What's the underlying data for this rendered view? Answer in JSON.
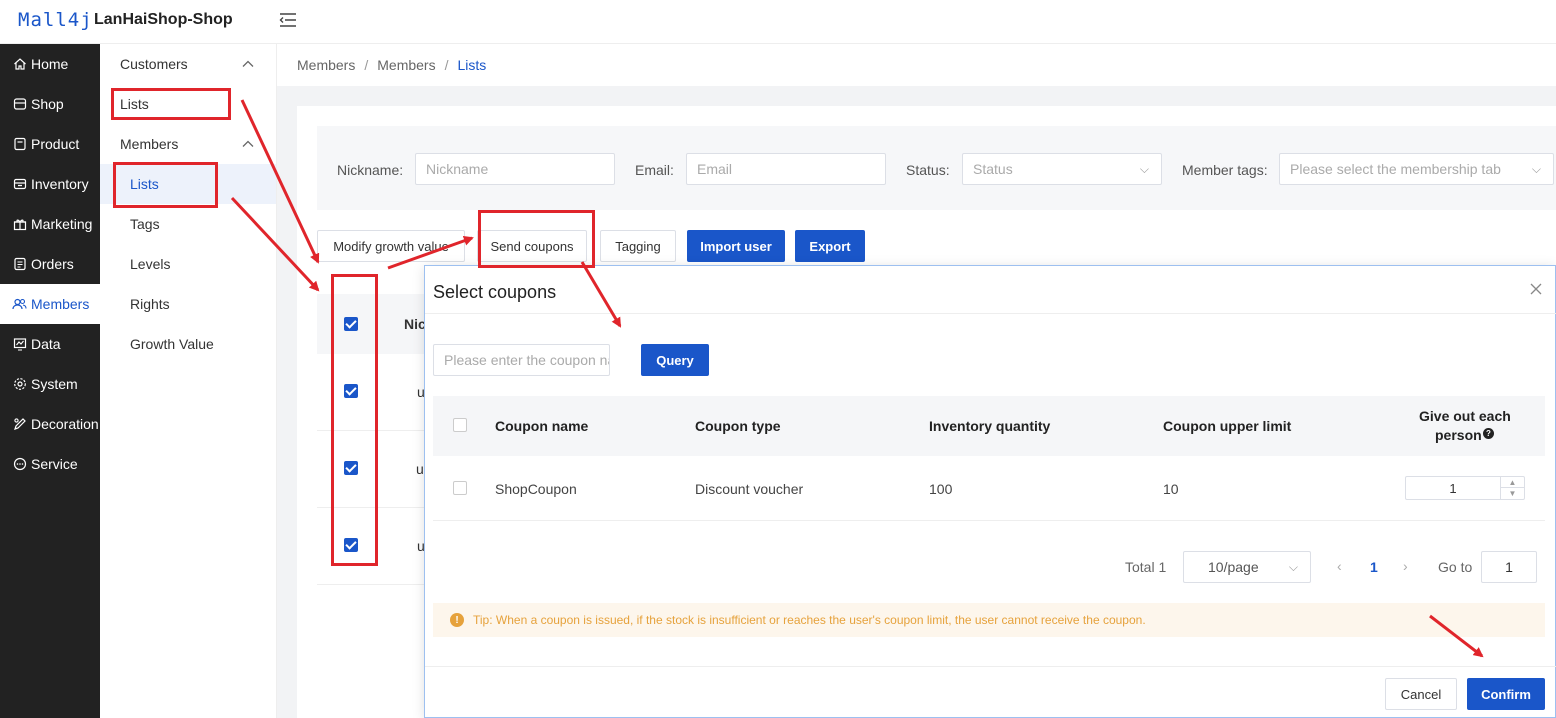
{
  "header": {
    "logo": "Mall4j",
    "shop_title": "LanHaiShop-Shop"
  },
  "sidebar": {
    "items": [
      {
        "label": "Home",
        "icon": "home-icon"
      },
      {
        "label": "Shop",
        "icon": "shop-icon"
      },
      {
        "label": "Product",
        "icon": "product-icon"
      },
      {
        "label": "Inventory",
        "icon": "inventory-icon"
      },
      {
        "label": "Marketing",
        "icon": "gift-icon"
      },
      {
        "label": "Orders",
        "icon": "orders-icon"
      },
      {
        "label": "Members",
        "icon": "members-icon",
        "active": true
      },
      {
        "label": "Data",
        "icon": "chart-icon"
      },
      {
        "label": "System",
        "icon": "gear-icon"
      },
      {
        "label": "Decoration",
        "icon": "brush-icon"
      },
      {
        "label": "Service",
        "icon": "chat-icon"
      }
    ]
  },
  "submenu": {
    "customers_group": "Customers",
    "customers_lists": "Lists",
    "members_group": "Members",
    "members_items": [
      "Lists",
      "Tags",
      "Levels",
      "Rights",
      "Growth Value"
    ]
  },
  "breadcrumb": [
    "Members",
    "Members",
    "Lists"
  ],
  "filter": {
    "nickname_label": "Nickname:",
    "nickname_placeholder": "Nickname",
    "email_label": "Email:",
    "email_placeholder": "Email",
    "status_label": "Status:",
    "status_placeholder": "Status",
    "tags_label": "Member tags:",
    "tags_placeholder": "Please select the membership tab"
  },
  "toolbar": {
    "modify_growth": "Modify growth value",
    "send_coupons": "Send coupons",
    "tagging": "Tagging",
    "import_user": "Import user",
    "export": "Export"
  },
  "table_peek": {
    "header_fragment": "Nic",
    "row_fragment": "u"
  },
  "dialog": {
    "title": "Select coupons",
    "search_placeholder": "Please enter the coupon name",
    "query_label": "Query",
    "columns": [
      "Coupon name",
      "Coupon type",
      "Inventory quantity",
      "Coupon upper limit",
      "Give out each",
      "person"
    ],
    "row": {
      "name": "ShopCoupon",
      "type": "Discount voucher",
      "inventory": "100",
      "upper_limit": "10",
      "each_person": "1"
    },
    "pagination": {
      "total": "Total 1",
      "page_size": "10/page",
      "current_page": "1",
      "goto_label": "Go to",
      "goto_value": "1"
    },
    "tip": "Tip: When a coupon is issued, if the stock is insufficient or reaches the user's coupon limit, the user cannot receive the coupon.",
    "cancel_label": "Cancel",
    "confirm_label": "Confirm"
  },
  "colors": {
    "primary": "#1a56c9",
    "sidebar_bg": "#222222",
    "annotation_red": "#e0252b",
    "tip_text": "#e6a23c"
  }
}
